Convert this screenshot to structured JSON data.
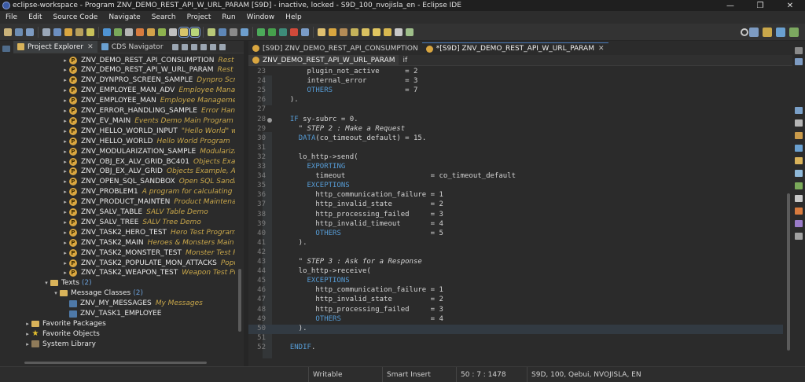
{
  "window": {
    "title": "eclipse-workspace - Program ZNV_DEMO_REST_API_W_URL_PARAM [S9D] - inactive, locked - S9D_100_nvojisla_en - Eclipse IDE",
    "controls": [
      "minimize-icon",
      "restore-icon",
      "close-icon"
    ]
  },
  "menu": [
    "File",
    "Edit",
    "Source Code",
    "Navigate",
    "Search",
    "Project",
    "Run",
    "Window",
    "Help"
  ],
  "colors": {
    "accent": "#4a7ec0",
    "keyword": "#569cd6",
    "comment": "#8a8a8a",
    "description": "#c9a74a",
    "count": "#6a9fd8",
    "program_icon": "#d9a640"
  },
  "left_tabs": [
    {
      "label": "Project Explorer",
      "active": true,
      "closable": true
    },
    {
      "label": "CDS Navigator",
      "active": false,
      "closable": false
    }
  ],
  "tree": [
    {
      "kind": "program",
      "name": "ZNV_DEMO_REST_API_CONSUMPTION",
      "desc": "Rest API Cor"
    },
    {
      "kind": "program",
      "name": "ZNV_DEMO_REST_API_W_URL_PARAM",
      "desc": "Rest API Cor"
    },
    {
      "kind": "program",
      "name": "ZNV_DYNPRO_SCREEN_SAMPLE",
      "desc": "Dynpro Screen Sar"
    },
    {
      "kind": "program",
      "name": "ZNV_EMPLOYEE_MAN_ADV",
      "desc": "Employee Manageme"
    },
    {
      "kind": "program",
      "name": "ZNV_EMPLOYEE_MAN",
      "desc": "Employee Management"
    },
    {
      "kind": "program",
      "name": "ZNV_ERROR_HANDLING_SAMPLE",
      "desc": "Error Handling Sa"
    },
    {
      "kind": "program",
      "name": "ZNV_EV_MAIN",
      "desc": "Events Demo Main Program"
    },
    {
      "kind": "program",
      "name": "ZNV_HELLO_WORLD_INPUT",
      "desc": "\"Hello World\" with user"
    },
    {
      "kind": "program",
      "name": "ZNV_HELLO_WORLD",
      "desc": "Hello World Program"
    },
    {
      "kind": "program",
      "name": "ZNV_MODULARIZATION_SAMPLE",
      "desc": "Modularization Sa"
    },
    {
      "kind": "program",
      "name": "ZNV_OBJ_EX_ALV_GRID_BC401",
      "desc": "Objects Example, ALV"
    },
    {
      "kind": "program",
      "name": "ZNV_OBJ_EX_ALV_GRID",
      "desc": "Objects Example, ALV Grid C"
    },
    {
      "kind": "program",
      "name": "ZNV_OPEN_SQL_SANDBOX",
      "desc": "Open SQL Sandbox"
    },
    {
      "kind": "program",
      "name": "ZNV_PROBLEM1",
      "desc": "A program for calculating the total"
    },
    {
      "kind": "program",
      "name": "ZNV_PRODUCT_MAINTEN",
      "desc": "Product Maintenance"
    },
    {
      "kind": "program",
      "name": "ZNV_SALV_TABLE",
      "desc": "SALV Table Demo"
    },
    {
      "kind": "program",
      "name": "ZNV_SALV_TREE",
      "desc": "SALV Tree Demo"
    },
    {
      "kind": "program",
      "name": "ZNV_TASK2_HERO_TEST",
      "desc": "Hero Test Program"
    },
    {
      "kind": "program",
      "name": "ZNV_TASK2_MAIN",
      "desc": "Heroes & Monsters Main Program"
    },
    {
      "kind": "program",
      "name": "ZNV_TASK2_MONSTER_TEST",
      "desc": "Monster Test Program"
    },
    {
      "kind": "program",
      "name": "ZNV_TASK2_POPULATE_MON_ATTACKS",
      "desc": "Populate M"
    },
    {
      "kind": "program",
      "name": "ZNV_TASK2_WEAPON_TEST",
      "desc": "Weapon Test Program"
    },
    {
      "kind": "folder",
      "name": "Texts",
      "count": "(2)"
    },
    {
      "kind": "folder",
      "name": "Message Classes",
      "count": "(2)"
    },
    {
      "kind": "msgclass",
      "name": "ZNV_MY_MESSAGES",
      "desc": "My Messages"
    },
    {
      "kind": "msgclass",
      "name": "ZNV_TASK1_EMPLOYEE",
      "desc": ""
    },
    {
      "kind": "favpkg",
      "name": "Favorite Packages"
    },
    {
      "kind": "favobj",
      "name": "Favorite Objects"
    },
    {
      "kind": "library",
      "name": "System Library"
    }
  ],
  "editor_tabs": [
    {
      "label": "[S9D] ZNV_DEMO_REST_API_CONSUMPTION",
      "active": false
    },
    {
      "label": "*[S9D] ZNV_DEMO_REST_API_W_URL_PARAM",
      "active": true
    }
  ],
  "inner_tabs": [
    {
      "label": "ZNV_DEMO_REST_API_W_URL_PARAM",
      "active": true
    },
    {
      "label": "if",
      "active": false
    }
  ],
  "code": [
    {
      "n": "23",
      "t": "      plugin_not_active      = 2"
    },
    {
      "n": "24",
      "t": "      internal_error         = 3"
    },
    {
      "n": "25",
      "t": "      OTHERS                 = 7"
    },
    {
      "n": "26",
      "t": "  )."
    },
    {
      "n": "27",
      "t": ""
    },
    {
      "n": "28",
      "t": "  IF sy-subrc = 0."
    },
    {
      "n": "29",
      "t": "    \" STEP 2 : Make a Request"
    },
    {
      "n": "30",
      "t": "    DATA(co_timeout_default) = 15."
    },
    {
      "n": "31",
      "t": ""
    },
    {
      "n": "32",
      "t": "    lo_http->send("
    },
    {
      "n": "33",
      "t": "      EXPORTING"
    },
    {
      "n": "34",
      "t": "        timeout                    = co_timeout_default"
    },
    {
      "n": "35",
      "t": "      EXCEPTIONS"
    },
    {
      "n": "36",
      "t": "        http_communication_failure = 1"
    },
    {
      "n": "37",
      "t": "        http_invalid_state         = 2"
    },
    {
      "n": "38",
      "t": "        http_processing_failed     = 3"
    },
    {
      "n": "39",
      "t": "        http_invalid_timeout       = 4"
    },
    {
      "n": "40",
      "t": "        OTHERS                     = 5"
    },
    {
      "n": "41",
      "t": "    )."
    },
    {
      "n": "42",
      "t": ""
    },
    {
      "n": "43",
      "t": "    \" STEP 3 : Ask for a Response"
    },
    {
      "n": "44",
      "t": "    lo_http->receive("
    },
    {
      "n": "45",
      "t": "      EXCEPTIONS"
    },
    {
      "n": "46",
      "t": "        http_communication_failure = 1"
    },
    {
      "n": "47",
      "t": "        http_invalid_state         = 2"
    },
    {
      "n": "48",
      "t": "        http_processing_failed     = 3"
    },
    {
      "n": "49",
      "t": "        OTHERS                     = 4"
    },
    {
      "n": "50",
      "t": "    )."
    },
    {
      "n": "51",
      "t": ""
    },
    {
      "n": "52",
      "t": "  ENDIF."
    }
  ],
  "status": {
    "mode": "Writable",
    "insert": "Smart Insert",
    "position": "50 : 7 : 1478",
    "system": "S9D, 100, Qebui, NVOJISLA, EN"
  }
}
